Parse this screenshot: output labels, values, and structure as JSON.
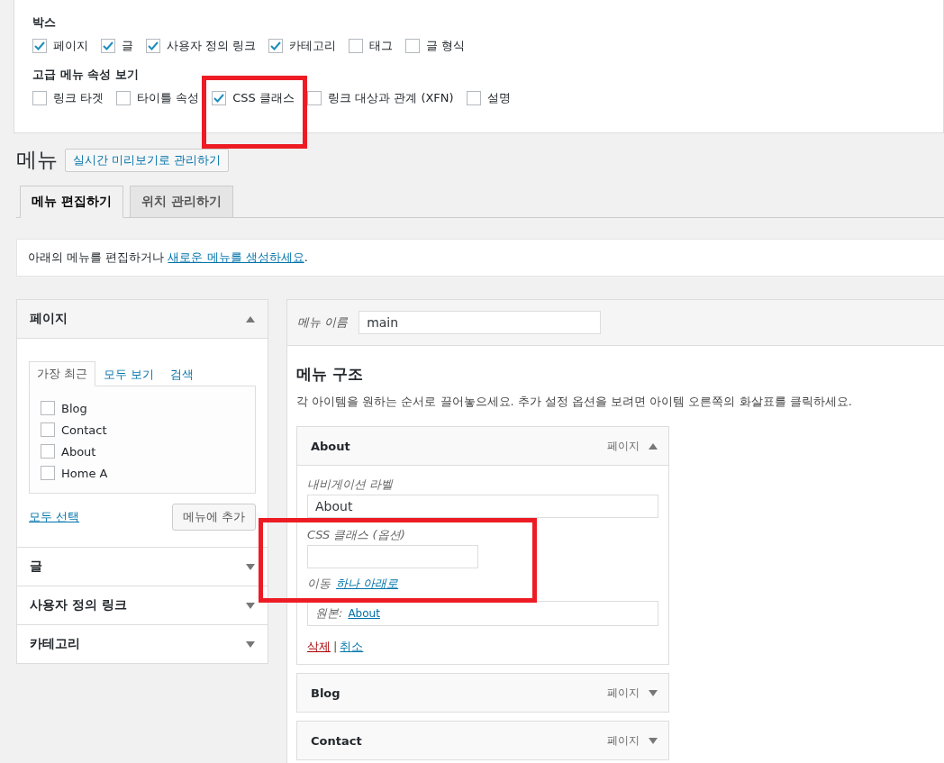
{
  "screen_options": {
    "boxes_title": "박스",
    "boxes": [
      {
        "label": "페이지",
        "checked": true
      },
      {
        "label": "글",
        "checked": true
      },
      {
        "label": "사용자 정의 링크",
        "checked": true
      },
      {
        "label": "카테고리",
        "checked": true
      },
      {
        "label": "태그",
        "checked": false
      },
      {
        "label": "글 형식",
        "checked": false
      }
    ],
    "advanced_title": "고급 메뉴 속성 보기",
    "advanced": [
      {
        "label": "링크 타겟",
        "checked": false
      },
      {
        "label": "타이틀 속성",
        "checked": false
      },
      {
        "label": "CSS 클래스",
        "checked": true
      },
      {
        "label": "링크 대상과 관계 (XFN)",
        "checked": false
      },
      {
        "label": "설명",
        "checked": false
      }
    ]
  },
  "header": {
    "title": "메뉴",
    "button": "실시간 미리보기로 관리하기"
  },
  "tabs": [
    {
      "label": "메뉴 편집하기",
      "selected": true
    },
    {
      "label": "위치 관리하기",
      "selected": false
    }
  ],
  "notice": {
    "text": "아래의 메뉴를 편집하거나 ",
    "link": "새로운 메뉴를 생성하세요",
    "end": "."
  },
  "sidebar": {
    "sections": [
      {
        "title": "페이지",
        "expanded": true,
        "tabs": [
          {
            "label": "가장 최근",
            "selected": true
          },
          {
            "label": "모두 보기",
            "selected": false
          },
          {
            "label": "검색",
            "selected": false
          }
        ],
        "items": [
          {
            "label": "Blog",
            "checked": false
          },
          {
            "label": "Contact",
            "checked": false
          },
          {
            "label": "About",
            "checked": false
          },
          {
            "label": "Home A",
            "checked": false
          }
        ],
        "select_all": "모두 선택",
        "add_button": "메뉴에 추가"
      },
      {
        "title": "글",
        "expanded": false
      },
      {
        "title": "사용자 정의 링크",
        "expanded": false
      },
      {
        "title": "카테고리",
        "expanded": false
      }
    ]
  },
  "menu_editor": {
    "name_label": "메뉴 이름",
    "name_value": "main",
    "structure_title": "메뉴 구조",
    "description": "각 아이템을 원하는 순서로 끌어놓으세요. 추가 설정 옵션을 보려면 아이템 오른쪽의 화살표를 클릭하세요.",
    "items": [
      {
        "title": "About",
        "type": "페이지",
        "expanded": true,
        "nav_label": "내비게이션 라벨",
        "nav_value": "About",
        "css_label": "CSS 클래스 (옵션)",
        "move_label": "이동",
        "move_link": "하나 아래로",
        "original_label": "원본:",
        "original_link": "About",
        "delete": "삭제",
        "separator": "|",
        "cancel": "취소"
      },
      {
        "title": "Blog",
        "type": "페이지",
        "expanded": false
      },
      {
        "title": "Contact",
        "type": "페이지",
        "expanded": false
      }
    ]
  }
}
